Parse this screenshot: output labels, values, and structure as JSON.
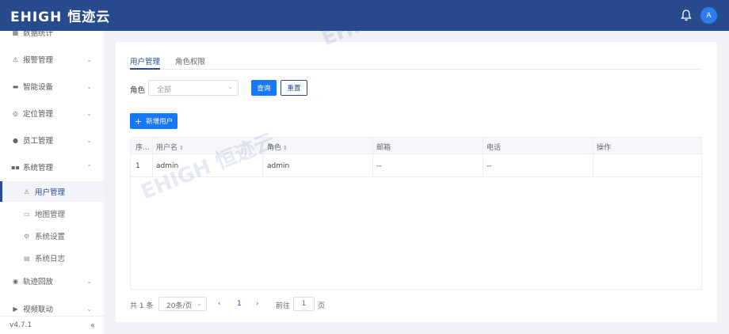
{
  "header": {
    "logo_text": "EHIGH 恒迹云",
    "avatar_letter": "A",
    "bell_icon": "bell-icon"
  },
  "sidebar": {
    "items": [
      {
        "label": "数据统计",
        "icon": "chart-icon"
      },
      {
        "label": "报警管理",
        "icon": "alarm-icon"
      },
      {
        "label": "智能设备",
        "icon": "device-icon"
      },
      {
        "label": "定位管理",
        "icon": "location-icon"
      },
      {
        "label": "员工管理",
        "icon": "person-icon"
      },
      {
        "label": "系统管理",
        "icon": "grid-icon"
      }
    ],
    "sub_items": [
      {
        "label": "用户管理",
        "icon": "user-icon"
      },
      {
        "label": "地图管理",
        "icon": "map-icon"
      },
      {
        "label": "系统设置",
        "icon": "gear-icon"
      },
      {
        "label": "系统日志",
        "icon": "doc-icon"
      }
    ],
    "items_after": [
      {
        "label": "轨迹回放",
        "icon": "track-icon"
      },
      {
        "label": "视频联动",
        "icon": "video-icon"
      }
    ],
    "version": "v4.7.1",
    "collapse_icon": "double-chevron-left-icon"
  },
  "tabs": [
    "用户管理",
    "角色权限"
  ],
  "filter": {
    "role_label": "角色",
    "role_value": "全部",
    "query_label": "查询",
    "reset_label": "重置"
  },
  "add_button_label": "新增用户",
  "table": {
    "headers": [
      "序...",
      "用户名",
      "角色",
      "邮箱",
      "电话",
      "操作"
    ],
    "rows": [
      [
        "1",
        "admin",
        "admin",
        "--",
        "--",
        ""
      ]
    ]
  },
  "pager": {
    "total": "共 1 条",
    "page_size": "20条/页",
    "current_page": "1",
    "goto_label": "前往",
    "goto_value": "1",
    "page_suffix": "页"
  },
  "watermark_text": "EHIGH 恒迹云",
  "colors": {
    "header_bg": "#274b8c",
    "primary": "#1677ff",
    "avatar": "#2d7cf0"
  }
}
